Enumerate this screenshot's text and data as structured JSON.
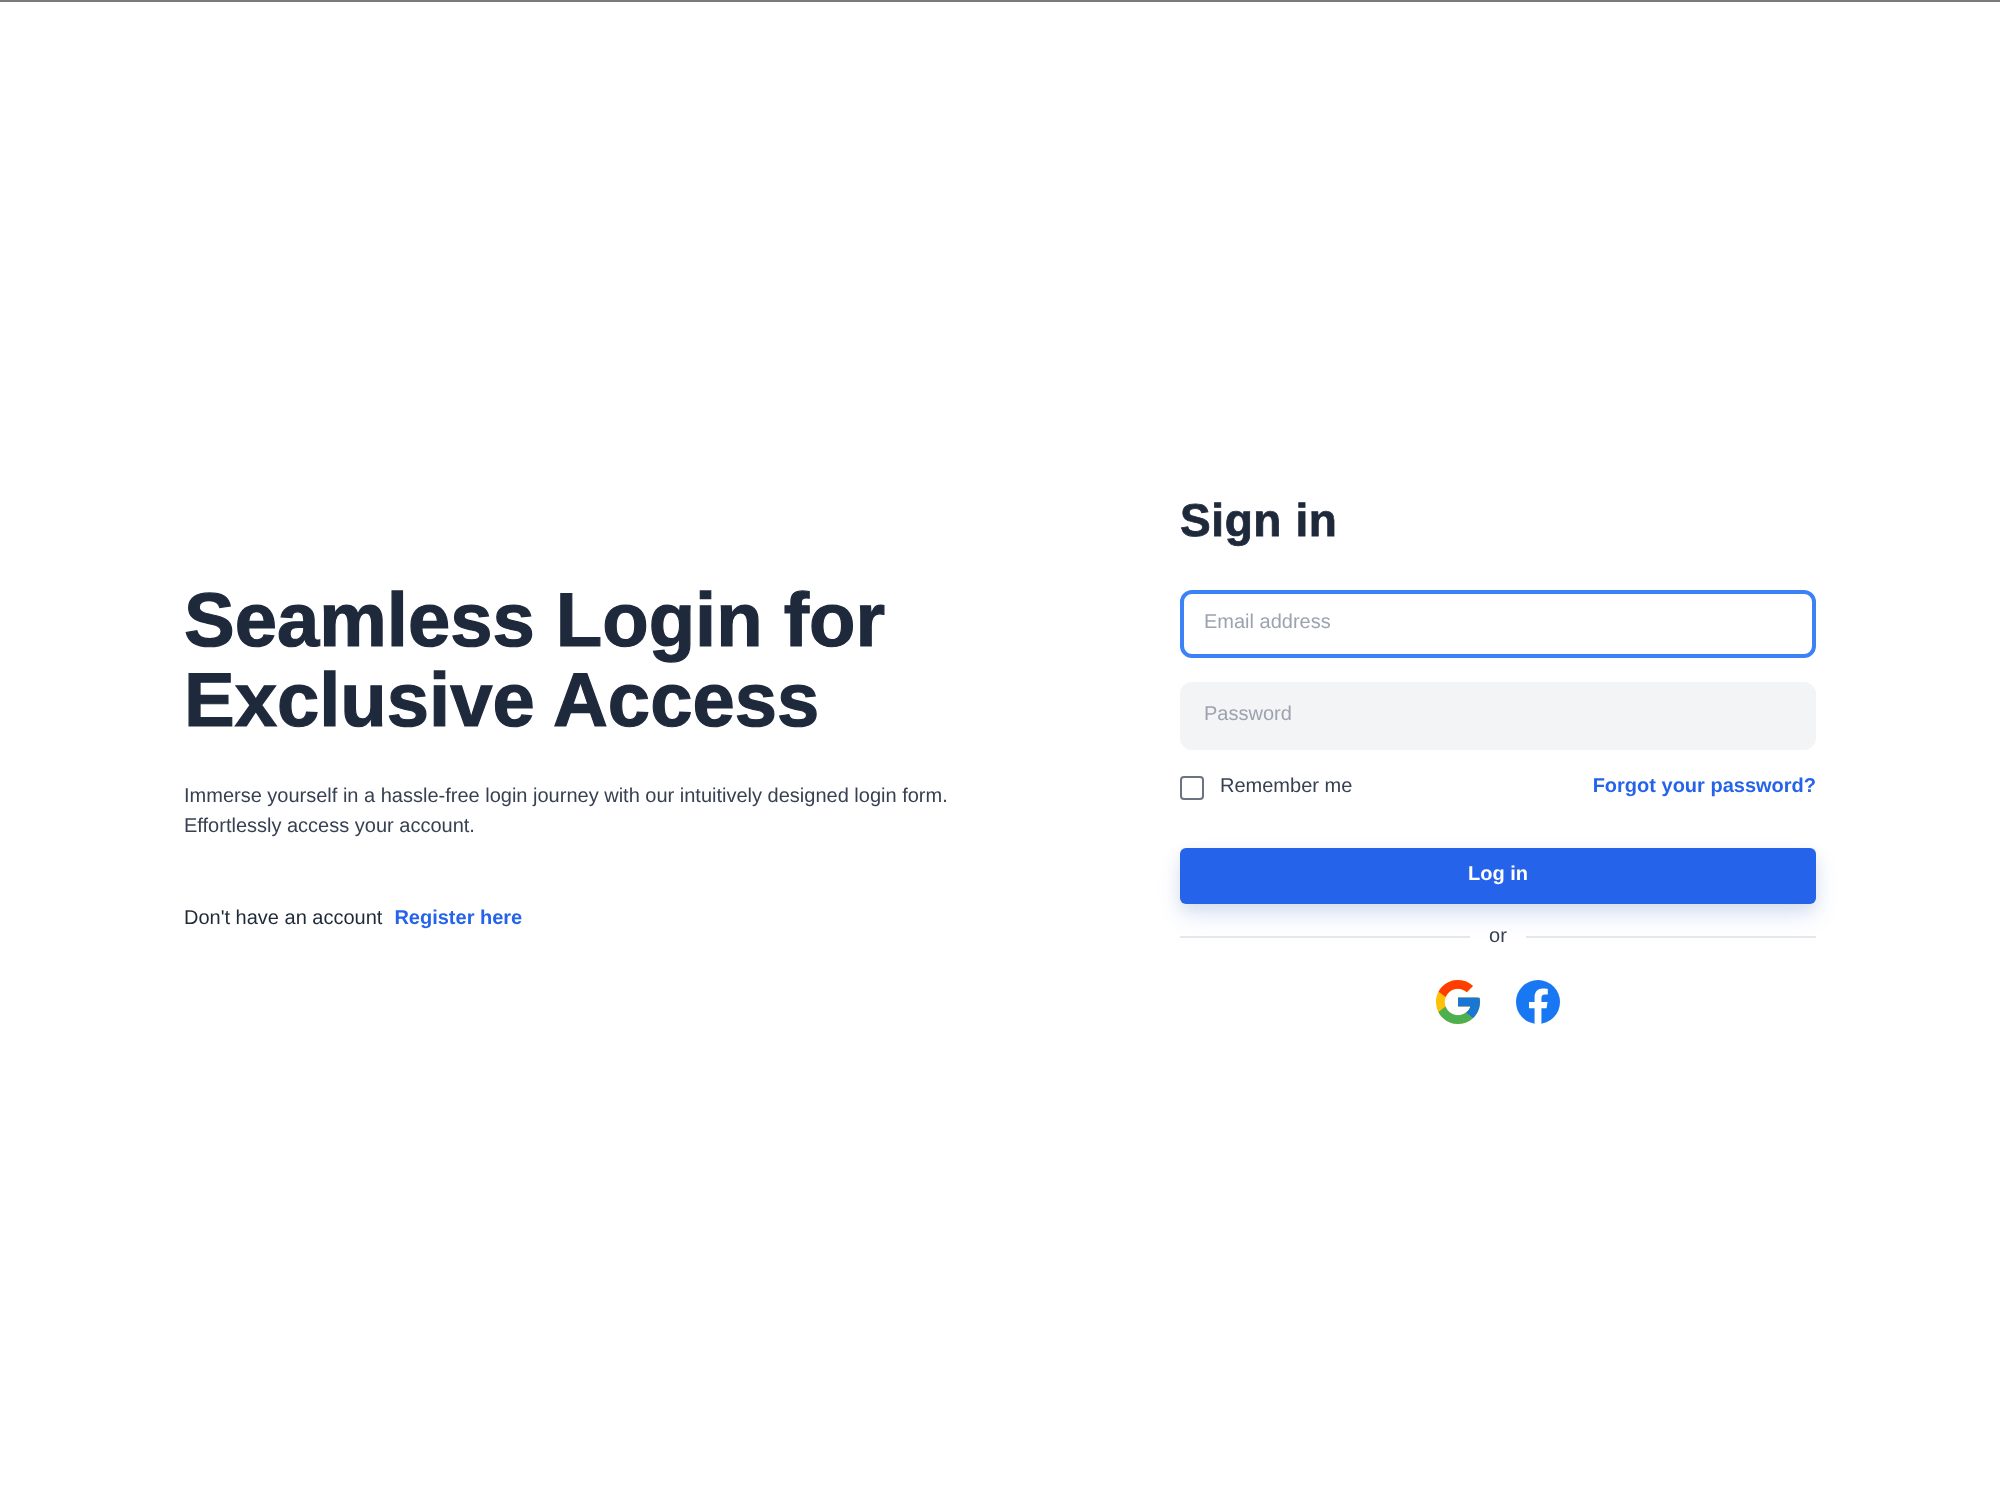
{
  "hero": {
    "title": "Seamless Login for Exclusive Access",
    "description": "Immerse yourself in a hassle-free login journey with our intuitively designed login form. Effortlessly access your account.",
    "register_prompt": "Don't have an account",
    "register_link": "Register here"
  },
  "signin": {
    "title": "Sign in",
    "fields": [
      {
        "placeholder": "Email address",
        "focused": true
      },
      {
        "placeholder": "Password",
        "focused": false
      }
    ],
    "remember": {
      "label": "Remember me",
      "checked": false
    },
    "forgot_link": "Forgot your password?",
    "submit": "Log in",
    "divider": "or"
  }
}
